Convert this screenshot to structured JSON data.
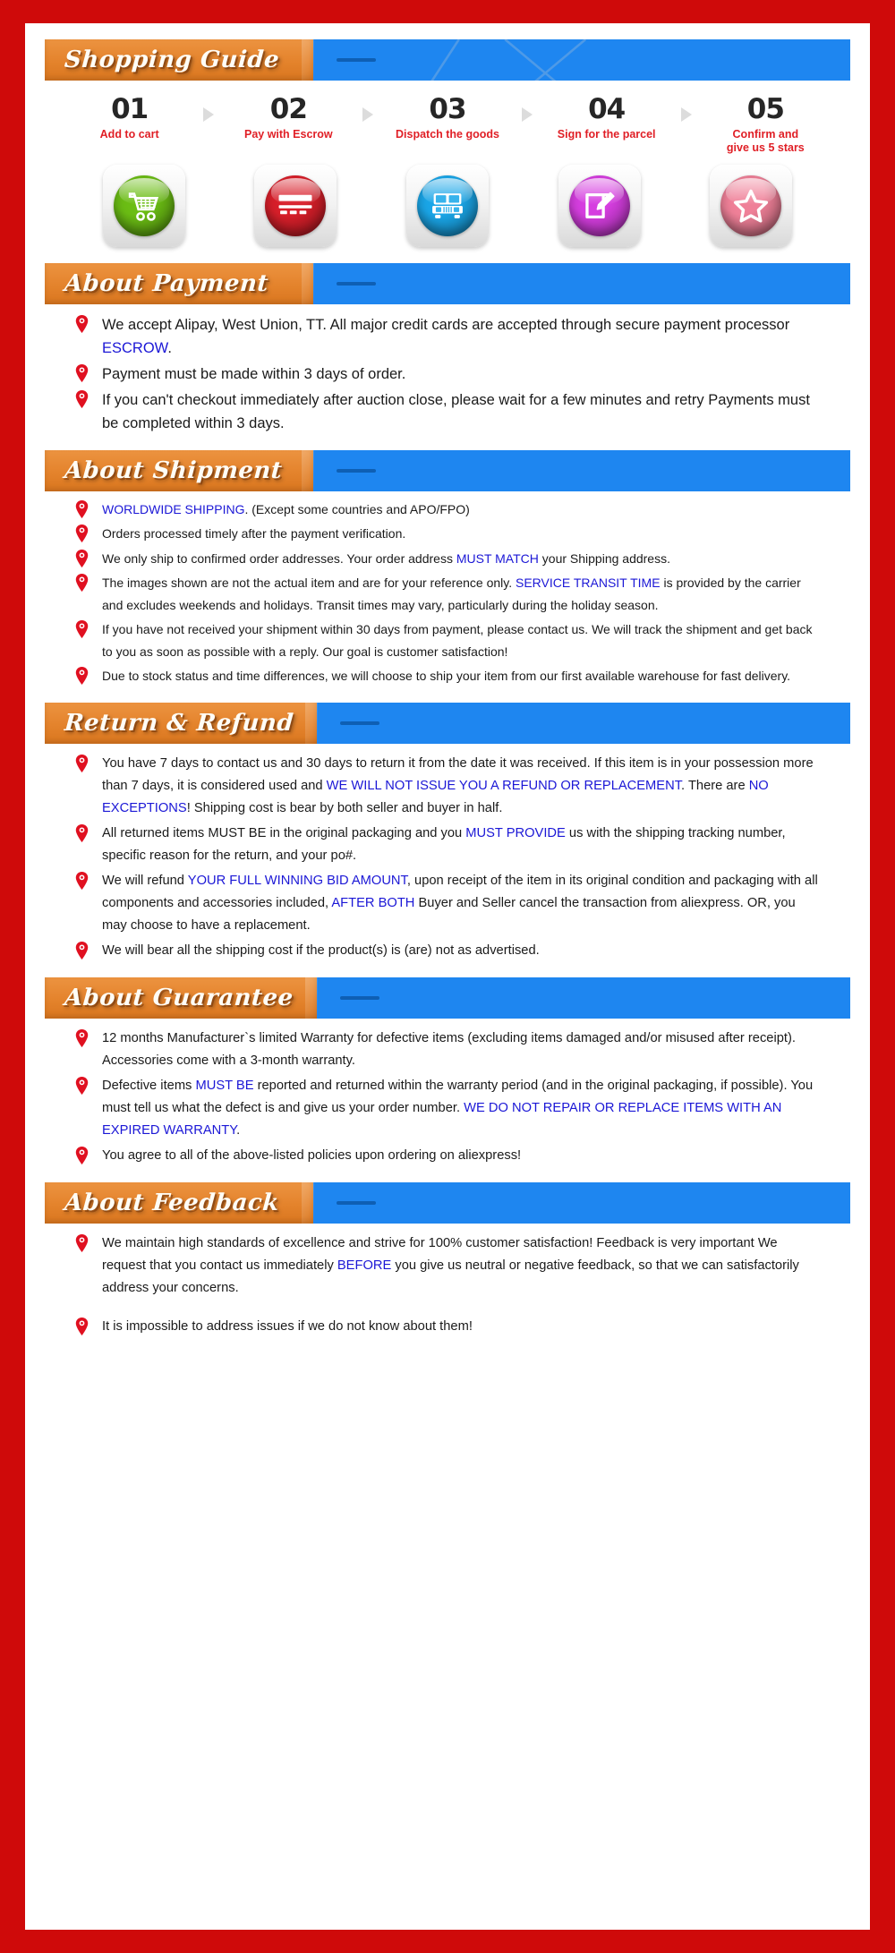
{
  "theme": {
    "frame_red": "#cf0a0a",
    "header_orange": "#e4832c",
    "header_blue": "#1e86f0",
    "link_blue": "#1b17d6",
    "step_label_red": "#e01f26"
  },
  "guide": {
    "title": "Shopping Guide",
    "steps": [
      {
        "num": "01",
        "label": "Add to cart",
        "icon": "shopping-cart-icon",
        "color": "#6bbd14"
      },
      {
        "num": "02",
        "label": "Pay with Escrow",
        "icon": "credit-card-icon",
        "color": "#d81f2a"
      },
      {
        "num": "03",
        "label": "Dispatch the goods",
        "icon": "delivery-truck-icon",
        "color": "#1aa6e8"
      },
      {
        "num": "04",
        "label": "Sign for the parcel",
        "icon": "sign-document-icon",
        "color": "#d63ee0"
      },
      {
        "num": "05",
        "label": "Confirm and\ngive us 5 stars",
        "icon": "star-rating-icon",
        "color": "#ef8098"
      }
    ]
  },
  "payment": {
    "title": "About Payment",
    "items": [
      {
        "segments": [
          {
            "t": "We accept Alipay, West Union, TT. All major credit cards are accepted through secure payment processor "
          },
          {
            "t": "ESCROW",
            "link": true
          },
          {
            "t": "."
          }
        ]
      },
      {
        "segments": [
          {
            "t": "Payment must be made within 3 days of order."
          }
        ]
      },
      {
        "segments": [
          {
            "t": "If you can't checkout immediately after auction close, please wait for a few minutes and retry Payments must be completed within 3 days."
          }
        ]
      }
    ]
  },
  "shipment": {
    "title": "About Shipment",
    "items": [
      {
        "segments": [
          {
            "t": "WORLDWIDE SHIPPING",
            "link": true
          },
          {
            "t": ". (Except some countries and APO/FPO)"
          }
        ]
      },
      {
        "segments": [
          {
            "t": "Orders processed timely after the payment verification."
          }
        ]
      },
      {
        "segments": [
          {
            "t": "We only ship to confirmed order addresses. Your order address "
          },
          {
            "t": "MUST MATCH",
            "link": true
          },
          {
            "t": " your Shipping address."
          }
        ]
      },
      {
        "segments": [
          {
            "t": "The images shown are not the actual item and are for your reference only. "
          },
          {
            "t": "SERVICE TRANSIT TIME",
            "link": true
          },
          {
            "t": " is provided by the carrier and excludes weekends and holidays. Transit times may vary, particularly during the holiday season."
          }
        ]
      },
      {
        "segments": [
          {
            "t": "If you have not received your shipment within 30 days from payment, please contact us. We will track the shipment and get back to you as soon as possible with a reply. Our goal is customer satisfaction!"
          }
        ]
      },
      {
        "segments": [
          {
            "t": "Due to stock status and time differences, we will choose to ship your item from our first available warehouse for fast delivery."
          }
        ]
      }
    ]
  },
  "returns": {
    "title": "Return & Refund",
    "items": [
      {
        "segments": [
          {
            "t": "You have 7 days to contact us and 30 days to return it from the date it was received. If this item is in your possession more than 7 days, it is considered used and "
          },
          {
            "t": "WE WILL NOT ISSUE YOU A REFUND OR REPLACEMENT",
            "link": true
          },
          {
            "t": ". There are "
          },
          {
            "t": "NO EXCEPTIONS",
            "link": true
          },
          {
            "t": "! Shipping cost is bear by both seller and buyer in half."
          }
        ]
      },
      {
        "segments": [
          {
            "t": "All returned items MUST BE in the original packaging and you "
          },
          {
            "t": "MUST PROVIDE",
            "link": true
          },
          {
            "t": " us with the shipping tracking number, specific reason for the return, and your po#."
          }
        ]
      },
      {
        "segments": [
          {
            "t": "We will refund "
          },
          {
            "t": "YOUR FULL WINNING BID AMOUNT",
            "link": true
          },
          {
            "t": ", upon receipt of the item in its original condition and packaging with all components and accessories included, "
          },
          {
            "t": "AFTER BOTH",
            "link": true
          },
          {
            "t": " Buyer and Seller cancel the transaction from aliexpress. OR, you may choose to have a replacement."
          }
        ]
      },
      {
        "segments": [
          {
            "t": "We will bear all the shipping cost if the product(s) is (are) not as advertised."
          }
        ]
      }
    ]
  },
  "guarantee": {
    "title": "About Guarantee",
    "items": [
      {
        "segments": [
          {
            "t": "12 months Manufacturer`s limited Warranty for defective items (excluding items damaged and/or misused after receipt). Accessories come with a 3-month warranty."
          }
        ]
      },
      {
        "segments": [
          {
            "t": "Defective items "
          },
          {
            "t": "MUST BE",
            "link": true
          },
          {
            "t": " reported and returned within the warranty period (and in the original packaging, if possible). You must tell us what the defect is and give us your order number. "
          },
          {
            "t": "WE DO NOT REPAIR OR REPLACE ITEMS WITH AN EXPIRED WARRANTY",
            "link": true
          },
          {
            "t": "."
          }
        ]
      },
      {
        "segments": [
          {
            "t": "You agree to all of the above-listed policies upon ordering on aliexpress!"
          }
        ]
      }
    ]
  },
  "feedback": {
    "title": "About Feedback",
    "items": [
      {
        "segments": [
          {
            "t": "We maintain high standards of excellence and strive for 100% customer satisfaction! Feedback is very important We request that you contact us immediately "
          },
          {
            "t": "BEFORE",
            "link": true
          },
          {
            "t": " you give us neutral or negative feedback, so that we can satisfactorily address your concerns."
          }
        ]
      },
      {
        "segments": [
          {
            "t": "It is impossible to address issues if we do not know about them!"
          }
        ],
        "spaced": true
      }
    ]
  }
}
